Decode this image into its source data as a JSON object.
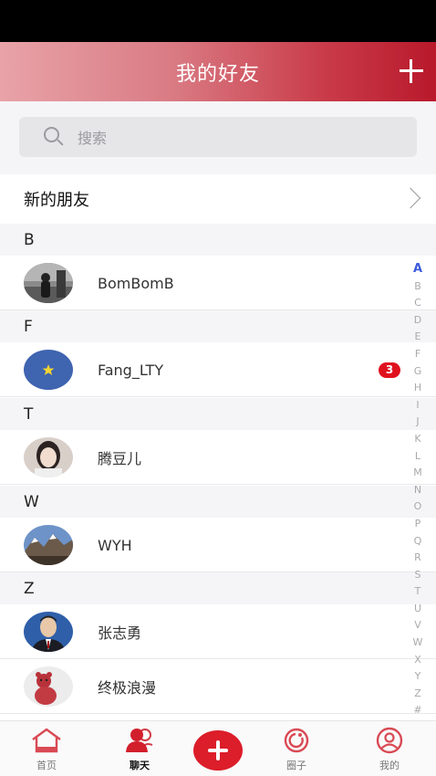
{
  "header": {
    "title": "我的好友"
  },
  "search": {
    "placeholder": "搜索"
  },
  "new_friends": {
    "label": "新的朋友"
  },
  "sections": [
    {
      "letter": "B",
      "contacts": [
        {
          "name": "BomBomB",
          "badge": ""
        }
      ]
    },
    {
      "letter": "F",
      "contacts": [
        {
          "name": "Fang_LTY",
          "badge": "3"
        }
      ]
    },
    {
      "letter": "T",
      "contacts": [
        {
          "name": "腾豆儿",
          "badge": ""
        }
      ]
    },
    {
      "letter": "W",
      "contacts": [
        {
          "name": "WYH",
          "badge": ""
        }
      ]
    },
    {
      "letter": "Z",
      "contacts": [
        {
          "name": "张志勇",
          "badge": ""
        },
        {
          "name": "终极浪漫",
          "badge": ""
        }
      ]
    }
  ],
  "index_letters": [
    "A",
    "B",
    "C",
    "D",
    "E",
    "F",
    "G",
    "H",
    "I",
    "J",
    "K",
    "L",
    "M",
    "N",
    "O",
    "P",
    "Q",
    "R",
    "S",
    "T",
    "U",
    "V",
    "W",
    "X",
    "Y",
    "Z",
    "#"
  ],
  "index_active": "A",
  "tabbar": {
    "home": "首页",
    "chat": "聊天",
    "circle": "圈子",
    "mine": "我的"
  },
  "colors": {
    "accent": "#dc1d2a",
    "badge": "#e0111f",
    "index_active": "#3d5bd9"
  }
}
